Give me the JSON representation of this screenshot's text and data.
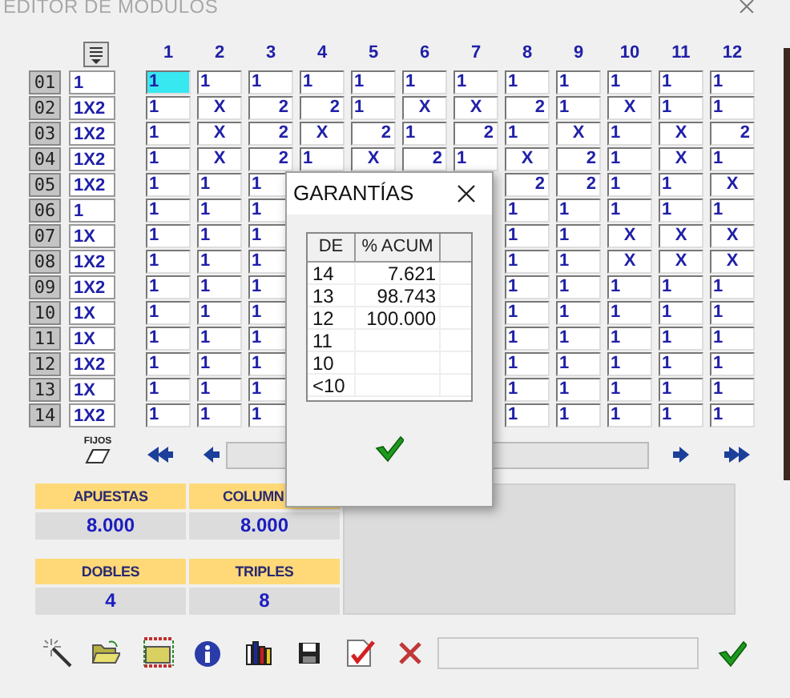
{
  "window": {
    "title": "EDITOR DE MODULOS"
  },
  "grid": {
    "column_numbers": [
      "1",
      "2",
      "3",
      "4",
      "5",
      "6",
      "7",
      "8",
      "9",
      "10",
      "11",
      "12"
    ],
    "rows": [
      {
        "label": "01",
        "bet": "1",
        "cells": [
          {
            "text": "1",
            "kind": "left",
            "selected": true
          },
          {
            "text": "1",
            "kind": "left",
            "selected": false
          },
          {
            "text": "1",
            "kind": "left",
            "selected": false
          },
          {
            "text": "1",
            "kind": "left",
            "selected": false
          },
          {
            "text": "1",
            "kind": "left",
            "selected": false
          },
          {
            "text": "1",
            "kind": "left",
            "selected": false
          },
          {
            "text": "1",
            "kind": "left",
            "selected": false
          },
          {
            "text": "1",
            "kind": "left",
            "selected": false
          },
          {
            "text": "1",
            "kind": "left",
            "selected": false
          },
          {
            "text": "1",
            "kind": "left",
            "selected": false
          },
          {
            "text": "1",
            "kind": "left",
            "selected": false
          },
          {
            "text": "1",
            "kind": "left",
            "selected": false
          }
        ]
      },
      {
        "label": "02",
        "bet": "1X2",
        "cells": [
          {
            "text": "1",
            "kind": "left",
            "selected": false
          },
          {
            "text": "X",
            "kind": "center",
            "selected": false
          },
          {
            "text": "2",
            "kind": "right",
            "selected": false
          },
          {
            "text": "2",
            "kind": "right",
            "selected": false
          },
          {
            "text": "1",
            "kind": "left",
            "selected": false
          },
          {
            "text": "X",
            "kind": "center",
            "selected": false
          },
          {
            "text": "X",
            "kind": "center",
            "selected": false
          },
          {
            "text": "2",
            "kind": "right",
            "selected": false
          },
          {
            "text": "1",
            "kind": "left",
            "selected": false
          },
          {
            "text": "X",
            "kind": "center",
            "selected": false
          },
          {
            "text": "1",
            "kind": "left",
            "selected": false
          },
          {
            "text": "1",
            "kind": "left",
            "selected": false
          }
        ]
      },
      {
        "label": "03",
        "bet": "1X2",
        "cells": [
          {
            "text": "1",
            "kind": "left",
            "selected": false
          },
          {
            "text": "X",
            "kind": "center",
            "selected": false
          },
          {
            "text": "2",
            "kind": "right",
            "selected": false
          },
          {
            "text": "X",
            "kind": "center",
            "selected": false
          },
          {
            "text": "2",
            "kind": "right",
            "selected": false
          },
          {
            "text": "1",
            "kind": "left",
            "selected": false
          },
          {
            "text": "2",
            "kind": "right",
            "selected": false
          },
          {
            "text": "1",
            "kind": "left",
            "selected": false
          },
          {
            "text": "X",
            "kind": "center",
            "selected": false
          },
          {
            "text": "1",
            "kind": "left",
            "selected": false
          },
          {
            "text": "X",
            "kind": "center",
            "selected": false
          },
          {
            "text": "2",
            "kind": "right",
            "selected": false
          }
        ]
      },
      {
        "label": "04",
        "bet": "1X2",
        "cells": [
          {
            "text": "1",
            "kind": "left",
            "selected": false
          },
          {
            "text": "X",
            "kind": "center",
            "selected": false
          },
          {
            "text": "2",
            "kind": "right",
            "selected": false
          },
          {
            "text": "1",
            "kind": "left",
            "selected": false
          },
          {
            "text": "X",
            "kind": "center",
            "selected": false
          },
          {
            "text": "2",
            "kind": "right",
            "selected": false
          },
          {
            "text": "1",
            "kind": "left",
            "selected": false
          },
          {
            "text": "X",
            "kind": "center",
            "selected": false
          },
          {
            "text": "2",
            "kind": "right",
            "selected": false
          },
          {
            "text": "1",
            "kind": "left",
            "selected": false
          },
          {
            "text": "X",
            "kind": "center",
            "selected": false
          },
          {
            "text": "1",
            "kind": "left",
            "selected": false
          }
        ]
      },
      {
        "label": "05",
        "bet": "1X2",
        "cells": [
          {
            "text": "1",
            "kind": "left",
            "selected": false
          },
          {
            "text": "1",
            "kind": "left",
            "selected": false
          },
          {
            "text": "1",
            "kind": "left",
            "selected": false
          },
          null,
          null,
          null,
          null,
          {
            "text": "2",
            "kind": "right",
            "selected": false
          },
          {
            "text": "2",
            "kind": "right",
            "selected": false
          },
          {
            "text": "1",
            "kind": "left",
            "selected": false
          },
          {
            "text": "1",
            "kind": "left",
            "selected": false
          },
          {
            "text": "X",
            "kind": "center",
            "selected": false
          }
        ]
      },
      {
        "label": "06",
        "bet": "1",
        "cells": [
          {
            "text": "1",
            "kind": "left",
            "selected": false
          },
          {
            "text": "1",
            "kind": "left",
            "selected": false
          },
          {
            "text": "1",
            "kind": "left",
            "selected": false
          },
          null,
          null,
          null,
          null,
          {
            "text": "1",
            "kind": "left",
            "selected": false
          },
          {
            "text": "1",
            "kind": "left",
            "selected": false
          },
          {
            "text": "1",
            "kind": "left",
            "selected": false
          },
          {
            "text": "1",
            "kind": "left",
            "selected": false
          },
          {
            "text": "1",
            "kind": "left",
            "selected": false
          }
        ]
      },
      {
        "label": "07",
        "bet": "1X",
        "cells": [
          {
            "text": "1",
            "kind": "left",
            "selected": false
          },
          {
            "text": "1",
            "kind": "left",
            "selected": false
          },
          {
            "text": "1",
            "kind": "left",
            "selected": false
          },
          null,
          null,
          null,
          null,
          {
            "text": "1",
            "kind": "left",
            "selected": false
          },
          {
            "text": "1",
            "kind": "left",
            "selected": false
          },
          {
            "text": "X",
            "kind": "center",
            "selected": false
          },
          {
            "text": "X",
            "kind": "center",
            "selected": false
          },
          {
            "text": "X",
            "kind": "center",
            "selected": false
          }
        ]
      },
      {
        "label": "08",
        "bet": "1X2",
        "cells": [
          {
            "text": "1",
            "kind": "left",
            "selected": false
          },
          {
            "text": "1",
            "kind": "left",
            "selected": false
          },
          {
            "text": "1",
            "kind": "left",
            "selected": false
          },
          null,
          null,
          null,
          null,
          {
            "text": "1",
            "kind": "left",
            "selected": false
          },
          {
            "text": "1",
            "kind": "left",
            "selected": false
          },
          {
            "text": "X",
            "kind": "center",
            "selected": false
          },
          {
            "text": "X",
            "kind": "center",
            "selected": false
          },
          {
            "text": "X",
            "kind": "center",
            "selected": false
          }
        ]
      },
      {
        "label": "09",
        "bet": "1X2",
        "cells": [
          {
            "text": "1",
            "kind": "left",
            "selected": false
          },
          {
            "text": "1",
            "kind": "left",
            "selected": false
          },
          {
            "text": "1",
            "kind": "left",
            "selected": false
          },
          null,
          null,
          null,
          null,
          {
            "text": "1",
            "kind": "left",
            "selected": false
          },
          {
            "text": "1",
            "kind": "left",
            "selected": false
          },
          {
            "text": "1",
            "kind": "left",
            "selected": false
          },
          {
            "text": "1",
            "kind": "left",
            "selected": false
          },
          {
            "text": "1",
            "kind": "left",
            "selected": false
          }
        ]
      },
      {
        "label": "10",
        "bet": "1X",
        "cells": [
          {
            "text": "1",
            "kind": "left",
            "selected": false
          },
          {
            "text": "1",
            "kind": "left",
            "selected": false
          },
          {
            "text": "1",
            "kind": "left",
            "selected": false
          },
          null,
          null,
          null,
          null,
          {
            "text": "1",
            "kind": "left",
            "selected": false
          },
          {
            "text": "1",
            "kind": "left",
            "selected": false
          },
          {
            "text": "1",
            "kind": "left",
            "selected": false
          },
          {
            "text": "1",
            "kind": "left",
            "selected": false
          },
          {
            "text": "1",
            "kind": "left",
            "selected": false
          }
        ]
      },
      {
        "label": "11",
        "bet": "1X",
        "cells": [
          {
            "text": "1",
            "kind": "left",
            "selected": false
          },
          {
            "text": "1",
            "kind": "left",
            "selected": false
          },
          {
            "text": "1",
            "kind": "left",
            "selected": false
          },
          null,
          null,
          null,
          null,
          {
            "text": "1",
            "kind": "left",
            "selected": false
          },
          {
            "text": "1",
            "kind": "left",
            "selected": false
          },
          {
            "text": "1",
            "kind": "left",
            "selected": false
          },
          {
            "text": "1",
            "kind": "left",
            "selected": false
          },
          {
            "text": "1",
            "kind": "left",
            "selected": false
          }
        ]
      },
      {
        "label": "12",
        "bet": "1X2",
        "cells": [
          {
            "text": "1",
            "kind": "left",
            "selected": false
          },
          {
            "text": "1",
            "kind": "left",
            "selected": false
          },
          {
            "text": "1",
            "kind": "left",
            "selected": false
          },
          null,
          null,
          null,
          null,
          {
            "text": "1",
            "kind": "left",
            "selected": false
          },
          {
            "text": "1",
            "kind": "left",
            "selected": false
          },
          {
            "text": "1",
            "kind": "left",
            "selected": false
          },
          {
            "text": "1",
            "kind": "left",
            "selected": false
          },
          {
            "text": "1",
            "kind": "left",
            "selected": false
          }
        ]
      },
      {
        "label": "13",
        "bet": "1X",
        "cells": [
          {
            "text": "1",
            "kind": "left",
            "selected": false
          },
          {
            "text": "1",
            "kind": "left",
            "selected": false
          },
          {
            "text": "1",
            "kind": "left",
            "selected": false
          },
          null,
          null,
          null,
          null,
          {
            "text": "1",
            "kind": "left",
            "selected": false
          },
          {
            "text": "1",
            "kind": "left",
            "selected": false
          },
          {
            "text": "1",
            "kind": "left",
            "selected": false
          },
          {
            "text": "1",
            "kind": "left",
            "selected": false
          },
          {
            "text": "1",
            "kind": "left",
            "selected": false
          }
        ]
      },
      {
        "label": "14",
        "bet": "1X2",
        "cells": [
          {
            "text": "1",
            "kind": "left",
            "selected": false
          },
          {
            "text": "1",
            "kind": "left",
            "selected": false
          },
          {
            "text": "1",
            "kind": "left",
            "selected": false
          },
          null,
          null,
          null,
          null,
          {
            "text": "1",
            "kind": "left",
            "selected": false
          },
          {
            "text": "1",
            "kind": "left",
            "selected": false
          },
          {
            "text": "1",
            "kind": "left",
            "selected": false
          },
          {
            "text": "1",
            "kind": "left",
            "selected": false
          },
          {
            "text": "1",
            "kind": "left",
            "selected": false
          }
        ]
      }
    ]
  },
  "fijos_button": {
    "label": "FIJOS"
  },
  "stats": [
    {
      "label": "APUESTAS",
      "value": "8.000"
    },
    {
      "label": "COLUMN",
      "value": "8.000"
    },
    {
      "label": "DOBLES",
      "value": "4"
    },
    {
      "label": "TRIPLES",
      "value": "8"
    }
  ],
  "dialog": {
    "title": "GARANTÍAS",
    "columns": [
      "DE",
      "% ACUM"
    ],
    "rows": [
      {
        "de": "14",
        "pct": "7.621"
      },
      {
        "de": "13",
        "pct": "98.743"
      },
      {
        "de": "12",
        "pct": "100.000"
      },
      {
        "de": "11"
      },
      {
        "de": "10"
      },
      {
        "de": "<10"
      }
    ]
  }
}
